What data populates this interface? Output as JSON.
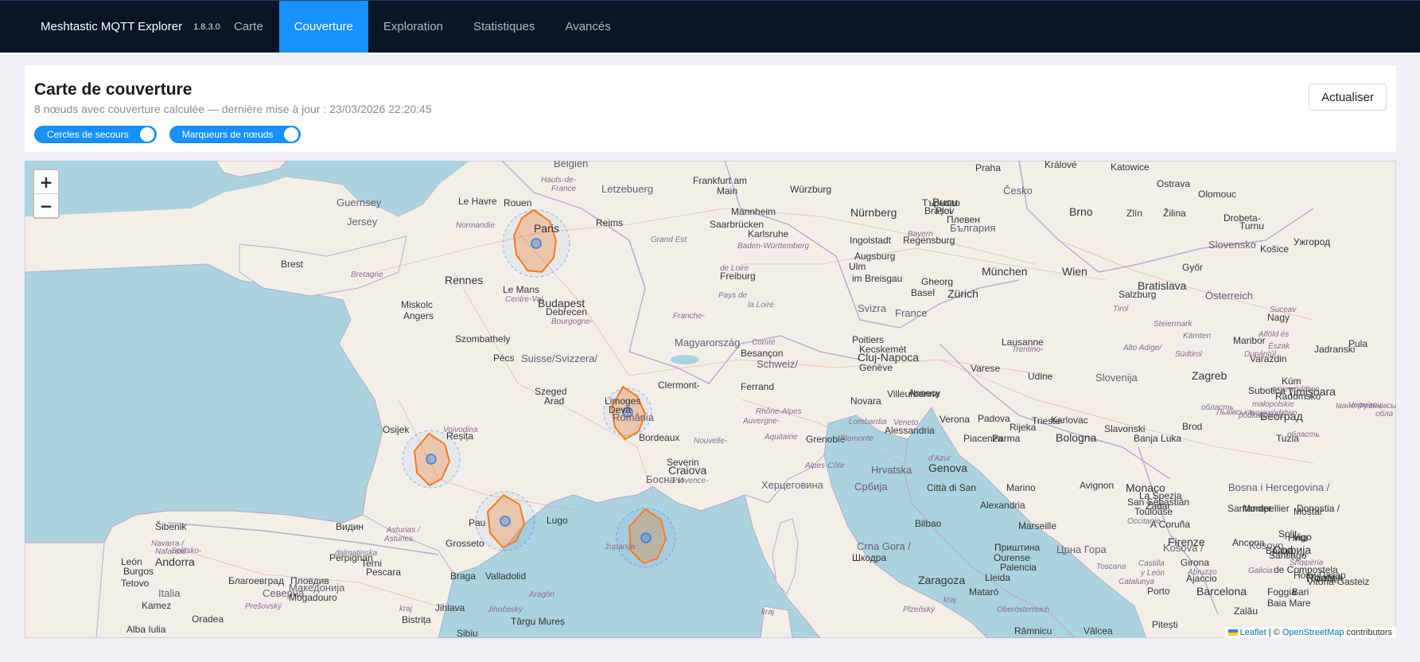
{
  "app": {
    "name": "Meshtastic MQTT Explorer",
    "version": "1.8.3.0"
  },
  "nav": {
    "tabs": [
      {
        "label": "Carte",
        "active": false
      },
      {
        "label": "Couverture",
        "active": true
      },
      {
        "label": "Exploration",
        "active": false
      },
      {
        "label": "Statistiques",
        "active": false
      },
      {
        "label": "Avancés",
        "active": false
      }
    ]
  },
  "panel": {
    "title": "Carte de couverture",
    "subtitle": "8 nœuds avec couverture calculée — dernière mise à jour : 23/03/2026 22:20:45",
    "refresh_label": "Actualiser",
    "toggles": [
      {
        "label": "Cercles de secours",
        "on": true
      },
      {
        "label": "Marqueurs de nœuds",
        "on": true
      }
    ]
  },
  "map": {
    "zoom_in": "+",
    "zoom_out": "−",
    "attribution": {
      "leaflet": "Leaflet",
      "separator": " | © ",
      "osm": "OpenStreetMap",
      "suffix": " contributors"
    },
    "colors": {
      "sea": "#aad3df",
      "land": "#f2efe9",
      "coverage": "#f47b20",
      "marker": "#2b7de9"
    },
    "labels": [
      {
        "text": "Belgien",
        "cls": "country"
      },
      {
        "text": "Letzebuerg",
        "cls": "country"
      },
      {
        "text": "Frankfurt am",
        "cls": "city"
      },
      {
        "text": "Main",
        "cls": "city"
      },
      {
        "text": "Würzburg",
        "cls": "city"
      },
      {
        "text": "Praha",
        "cls": "city"
      },
      {
        "text": "Králové",
        "cls": "city"
      },
      {
        "text": "Katowice",
        "cls": "city"
      },
      {
        "text": "Ostrava",
        "cls": "city"
      },
      {
        "text": "Česko",
        "cls": "country"
      },
      {
        "text": "Olomouc",
        "cls": "city"
      },
      {
        "text": "Brno",
        "cls": "big"
      },
      {
        "text": "Zlín",
        "cls": "city"
      },
      {
        "text": "Žilina",
        "cls": "city"
      },
      {
        "text": "Slovensko",
        "cls": "country"
      },
      {
        "text": "Košice",
        "cls": "city"
      },
      {
        "text": "Ужгород",
        "cls": "city"
      },
      {
        "text": "Guernsey",
        "cls": "country"
      },
      {
        "text": "Jersey",
        "cls": "country"
      },
      {
        "text": "Le Havre",
        "cls": "city"
      },
      {
        "text": "Rouen",
        "cls": "city"
      },
      {
        "text": "Hauts-de-",
        "cls": "region"
      },
      {
        "text": "France",
        "cls": "region"
      },
      {
        "text": "Normandie",
        "cls": "region"
      },
      {
        "text": "Paris",
        "cls": "big"
      },
      {
        "text": "Reims",
        "cls": "city"
      },
      {
        "text": "Mannheim",
        "cls": "city"
      },
      {
        "text": "Nürnberg",
        "cls": "big"
      },
      {
        "text": "Saarbrücken",
        "cls": "city"
      },
      {
        "text": "Karlsruhe",
        "cls": "city"
      },
      {
        "text": "Ingolstadt",
        "cls": "city"
      },
      {
        "text": "Regensburg",
        "cls": "city"
      },
      {
        "text": "Bayern",
        "cls": "region"
      },
      {
        "text": "Grand Est",
        "cls": "region"
      },
      {
        "text": "Baden-Württemberg",
        "cls": "region"
      },
      {
        "text": "Augsburg",
        "cls": "city"
      },
      {
        "text": "Ulm",
        "cls": "city"
      },
      {
        "text": "Brest",
        "cls": "city"
      },
      {
        "text": "Bretagne",
        "cls": "region"
      },
      {
        "text": "Rennes",
        "cls": "big"
      },
      {
        "text": "Le Mans",
        "cls": "city"
      },
      {
        "text": "Centre-Val",
        "cls": "region"
      },
      {
        "text": "de Loire",
        "cls": "region"
      },
      {
        "text": "Freiburg",
        "cls": "city"
      },
      {
        "text": "im Breisgau",
        "cls": "city"
      },
      {
        "text": "München",
        "cls": "big"
      },
      {
        "text": "Wien",
        "cls": "big"
      },
      {
        "text": "Bratislava",
        "cls": "big"
      },
      {
        "text": "Győr",
        "cls": "city"
      },
      {
        "text": "Miskolc",
        "cls": "city"
      },
      {
        "text": "Angers",
        "cls": "city"
      },
      {
        "text": "Pays de",
        "cls": "region"
      },
      {
        "text": "la Loire",
        "cls": "region"
      },
      {
        "text": "Basel",
        "cls": "city"
      },
      {
        "text": "Zürich",
        "cls": "big"
      },
      {
        "text": "Salzburg",
        "cls": "city"
      },
      {
        "text": "Österreich",
        "cls": "country"
      },
      {
        "text": "Budapest",
        "cls": "big"
      },
      {
        "text": "Debrecen",
        "cls": "city"
      },
      {
        "text": "Bourgogne-",
        "cls": "region"
      },
      {
        "text": "Franche-",
        "cls": "region"
      },
      {
        "text": "Comté",
        "cls": "region"
      },
      {
        "text": "Besançon",
        "cls": "city"
      },
      {
        "text": "Schweiz/",
        "cls": "country"
      },
      {
        "text": "Suisse/Svizzera/",
        "cls": "country"
      },
      {
        "text": "Svizra",
        "cls": "country"
      },
      {
        "text": "France",
        "cls": "country"
      },
      {
        "text": "Tirol",
        "cls": "region"
      },
      {
        "text": "Steiermark",
        "cls": "region"
      },
      {
        "text": "Szombathely",
        "cls": "city"
      },
      {
        "text": "Magyarország",
        "cls": "country"
      },
      {
        "text": "Poitiers",
        "cls": "city"
      },
      {
        "text": "Lausanne",
        "cls": "city"
      },
      {
        "text": "Kärnten",
        "cls": "region"
      },
      {
        "text": "Maribor",
        "cls": "city"
      },
      {
        "text": "Kecskemét",
        "cls": "city"
      },
      {
        "text": "Cluj-Napoca",
        "cls": "big"
      },
      {
        "text": "Genève",
        "cls": "city"
      },
      {
        "text": "Trentino-",
        "cls": "region"
      },
      {
        "text": "Alto Adige/",
        "cls": "region"
      },
      {
        "text": "Südtirol",
        "cls": "region"
      },
      {
        "text": "Varaždin",
        "cls": "city"
      },
      {
        "text": "Pécs",
        "cls": "city"
      },
      {
        "text": "Szeged",
        "cls": "city"
      },
      {
        "text": "Arad",
        "cls": "city"
      },
      {
        "text": "Limoges",
        "cls": "city"
      },
      {
        "text": "Clermont-",
        "cls": "city"
      },
      {
        "text": "Ferrand",
        "cls": "city"
      },
      {
        "text": "Villeurbanne",
        "cls": "city"
      },
      {
        "text": "Annecy",
        "cls": "city"
      },
      {
        "text": "Varese",
        "cls": "city"
      },
      {
        "text": "Udine",
        "cls": "city"
      },
      {
        "text": "Slovenija",
        "cls": "country"
      },
      {
        "text": "Zagreb",
        "cls": "big"
      },
      {
        "text": "Subotica",
        "cls": "city"
      },
      {
        "text": "Timișoara",
        "cls": "big"
      },
      {
        "text": "Deva",
        "cls": "city"
      },
      {
        "text": "România",
        "cls": "country"
      },
      {
        "text": "Auvergne-",
        "cls": "region"
      },
      {
        "text": "Rhône-Alpes",
        "cls": "region"
      },
      {
        "text": "Novara",
        "cls": "city"
      },
      {
        "text": "Lombardia",
        "cls": "region"
      },
      {
        "text": "Veneto",
        "cls": "region"
      },
      {
        "text": "Verona",
        "cls": "city"
      },
      {
        "text": "Padova",
        "cls": "city"
      },
      {
        "text": "Trieste",
        "cls": "city"
      },
      {
        "text": "Rijeka",
        "cls": "city"
      },
      {
        "text": "Karlovac",
        "cls": "city"
      },
      {
        "text": "Slavonski",
        "cls": "city"
      },
      {
        "text": "Brod",
        "cls": "city"
      },
      {
        "text": "Osijek",
        "cls": "city"
      },
      {
        "text": "Vojvodina",
        "cls": "region"
      },
      {
        "text": "Reșița",
        "cls": "city"
      },
      {
        "text": "Bordeaux",
        "cls": "city"
      },
      {
        "text": "Nouvelle-",
        "cls": "region"
      },
      {
        "text": "Aquitaine",
        "cls": "region"
      },
      {
        "text": "Grenoble",
        "cls": "city"
      },
      {
        "text": "Piemonte",
        "cls": "region"
      },
      {
        "text": "Alessandria",
        "cls": "city"
      },
      {
        "text": "Piacenza",
        "cls": "city"
      },
      {
        "text": "Parma",
        "cls": "city"
      },
      {
        "text": "Bologna",
        "cls": "big"
      },
      {
        "text": "Banja Luka",
        "cls": "city"
      },
      {
        "text": "Tuzla",
        "cls": "city"
      },
      {
        "text": "Београд",
        "cls": "big"
      },
      {
        "text": "Severin",
        "cls": "city"
      },
      {
        "text": "Craiova",
        "cls": "big"
      },
      {
        "text": "Provence-",
        "cls": "region"
      },
      {
        "text": "Alpes-Côte",
        "cls": "region"
      },
      {
        "text": "d'Azur",
        "cls": "region"
      },
      {
        "text": "Genova",
        "cls": "big"
      },
      {
        "text": "Hrvatska",
        "cls": "country"
      },
      {
        "text": "Città di San",
        "cls": "city"
      },
      {
        "text": "Marino",
        "cls": "city"
      },
      {
        "text": "Avignon",
        "cls": "city"
      },
      {
        "text": "Monaco",
        "cls": "big"
      },
      {
        "text": "La Spezia",
        "cls": "city"
      },
      {
        "text": "Zadar",
        "cls": "city"
      },
      {
        "text": "Bosna i Hercegovina /",
        "cls": "country"
      },
      {
        "text": "Босна и",
        "cls": "country"
      },
      {
        "text": "Херцеговина",
        "cls": "country"
      },
      {
        "text": "Србија",
        "cls": "country"
      },
      {
        "text": "Alexandria",
        "cls": "city"
      },
      {
        "text": "A Coruña",
        "cls": "city"
      },
      {
        "text": "Santander",
        "cls": "city"
      },
      {
        "text": "Donostia /",
        "cls": "city"
      },
      {
        "text": "San Sebastián",
        "cls": "city"
      },
      {
        "text": "Toulouse",
        "cls": "city"
      },
      {
        "text": "Occitanie",
        "cls": "region"
      },
      {
        "text": "Montpellier",
        "cls": "city"
      },
      {
        "text": "Firenze",
        "cls": "big"
      },
      {
        "text": "Ancona",
        "cls": "city"
      },
      {
        "text": "Šibenik",
        "cls": "city"
      },
      {
        "text": "Видин",
        "cls": "city"
      },
      {
        "text": "Asturias /",
        "cls": "region"
      },
      {
        "text": "Asturies",
        "cls": "region"
      },
      {
        "text": "Pau",
        "cls": "city"
      },
      {
        "text": "Lugo",
        "cls": "city"
      },
      {
        "text": "Bilbao",
        "cls": "city"
      },
      {
        "text": "Marseille",
        "cls": "city"
      },
      {
        "text": "Toscana",
        "cls": "region"
      },
      {
        "text": "Split",
        "cls": "city"
      },
      {
        "text": "Mostar",
        "cls": "city"
      },
      {
        "text": "Нови Пазар",
        "cls": "city"
      },
      {
        "text": "Ниш",
        "cls": "city"
      },
      {
        "text": "Враца",
        "cls": "city"
      },
      {
        "text": "Santiago",
        "cls": "city"
      },
      {
        "text": "de Compostela",
        "cls": "city"
      },
      {
        "text": "Galicia",
        "cls": "region"
      },
      {
        "text": "Vitoria-Gasteiz",
        "cls": "city"
      },
      {
        "text": "Navarra /",
        "cls": "region"
      },
      {
        "text": "Nafarroa",
        "cls": "region"
      },
      {
        "text": "Grosseto",
        "cls": "city"
      },
      {
        "text": "Splitsko-",
        "cls": "region"
      },
      {
        "text": "dalmatinska",
        "cls": "region"
      },
      {
        "text": "županija",
        "cls": "region"
      },
      {
        "text": "Crna Gora /",
        "cls": "country"
      },
      {
        "text": "Црна Гора",
        "cls": "country"
      },
      {
        "text": "Kosova /",
        "cls": "country"
      },
      {
        "text": "Kosovo",
        "cls": "country"
      },
      {
        "text": "Софија",
        "cls": "big"
      },
      {
        "text": "Vigo",
        "cls": "city"
      },
      {
        "text": "León",
        "cls": "city"
      },
      {
        "text": "Burgos",
        "cls": "city"
      },
      {
        "text": "Andorra",
        "cls": "big"
      },
      {
        "text": "Perpignan",
        "cls": "city"
      },
      {
        "text": "Terni",
        "cls": "city"
      },
      {
        "text": "Pescara",
        "cls": "city"
      },
      {
        "text": "Шкодра",
        "cls": "city"
      },
      {
        "text": "Приштина",
        "cls": "city"
      },
      {
        "text": "Ourense",
        "cls": "city"
      },
      {
        "text": "Palencia",
        "cls": "city"
      },
      {
        "text": "Castilla",
        "cls": "region"
      },
      {
        "text": "y León",
        "cls": "region"
      },
      {
        "text": "Girona",
        "cls": "city"
      },
      {
        "text": "Abruzzo",
        "cls": "region"
      },
      {
        "text": "Shqipëria",
        "cls": "region"
      },
      {
        "text": "Tetovo",
        "cls": "city"
      },
      {
        "text": "Благоевград",
        "cls": "city"
      },
      {
        "text": "Пловдив",
        "cls": "city"
      },
      {
        "text": "Braga",
        "cls": "city"
      },
      {
        "text": "Valladolid",
        "cls": "city"
      },
      {
        "text": "Zaragoza",
        "cls": "big"
      },
      {
        "text": "Lleida",
        "cls": "city"
      },
      {
        "text": "Catalunya",
        "cls": "region"
      },
      {
        "text": "Ajaccio",
        "cls": "city"
      },
      {
        "text": "Roma",
        "cls": "big"
      },
      {
        "text": "Latina",
        "cls": "city"
      },
      {
        "text": "Italia",
        "cls": "country"
      },
      {
        "text": "Северна",
        "cls": "country"
      },
      {
        "text": "Македонија",
        "cls": "country"
      },
      {
        "text": "Mogadouro",
        "cls": "city"
      },
      {
        "text": "Aragón",
        "cls": "region"
      },
      {
        "text": "Mataró",
        "cls": "city"
      },
      {
        "text": "Porto",
        "cls": "city"
      },
      {
        "text": "Barcelona",
        "cls": "big"
      },
      {
        "text": "Foggia",
        "cls": "city"
      },
      {
        "text": "Bari",
        "cls": "city"
      },
      {
        "text": "Kamez",
        "cls": "city"
      },
      {
        "text": "Prešovský",
        "cls": "region"
      },
      {
        "text": "kraj",
        "cls": "region"
      },
      {
        "text": "Jihlava",
        "cls": "city"
      },
      {
        "text": "Jihočeský",
        "cls": "region"
      },
      {
        "text": "kraj",
        "cls": "region"
      },
      {
        "text": "Plzeňský",
        "cls": "region"
      },
      {
        "text": "kraj",
        "cls": "region"
      },
      {
        "text": "Oberösterreich",
        "cls": "region"
      },
      {
        "text": "Baia Mare",
        "cls": "city"
      },
      {
        "text": "Zalău",
        "cls": "city"
      },
      {
        "text": "Oradea",
        "cls": "city"
      },
      {
        "text": "Bistrița",
        "cls": "city"
      },
      {
        "text": "Târgu Mureș",
        "cls": "city"
      },
      {
        "text": "Alba Iulia",
        "cls": "city"
      },
      {
        "text": "Sibiu",
        "cls": "city"
      },
      {
        "text": "Râmnicu",
        "cls": "city"
      },
      {
        "text": "Vâlcea",
        "cls": "city"
      },
      {
        "text": "Pitești",
        "cls": "city"
      },
      {
        "text": "Drobeta-",
        "cls": "city"
      },
      {
        "text": "Turnu",
        "cls": "city"
      },
      {
        "text": "Плевен",
        "cls": "city"
      },
      {
        "text": "България",
        "cls": "country"
      },
      {
        "text": "Търново",
        "cls": "city"
      },
      {
        "text": "Brașov",
        "cls": "city"
      },
      {
        "text": "Bucu",
        "cls": "big"
      },
      {
        "text": "Ploi",
        "cls": "city"
      },
      {
        "text": "Gheorg",
        "cls": "city"
      },
      {
        "text": "Suceav",
        "cls": "region"
      },
      {
        "text": "Nagy",
        "cls": "city"
      },
      {
        "text": "Alföld és",
        "cls": "region"
      },
      {
        "text": "Észak",
        "cls": "region"
      },
      {
        "text": "Dunántúl",
        "cls": "region"
      },
      {
        "text": "Kúm",
        "cls": "city"
      },
      {
        "text": "Radomsko",
        "cls": "city"
      },
      {
        "text": "województwo",
        "cls": "region"
      },
      {
        "text": "małopolskie",
        "cls": "region"
      },
      {
        "text": "województwo",
        "cls": "region"
      },
      {
        "text": "podkarpackie",
        "cls": "region"
      },
      {
        "text": "Львівська",
        "cls": "region"
      },
      {
        "text": "область",
        "cls": "region"
      },
      {
        "text": "Івано-Франківська",
        "cls": "region"
      },
      {
        "text": "область",
        "cls": "region"
      },
      {
        "text": "Чернівец",
        "cls": "region"
      },
      {
        "text": "обла",
        "cls": "region"
      },
      {
        "text": "Pula",
        "cls": "city"
      },
      {
        "text": "Jadranski",
        "cls": "city"
      }
    ]
  }
}
